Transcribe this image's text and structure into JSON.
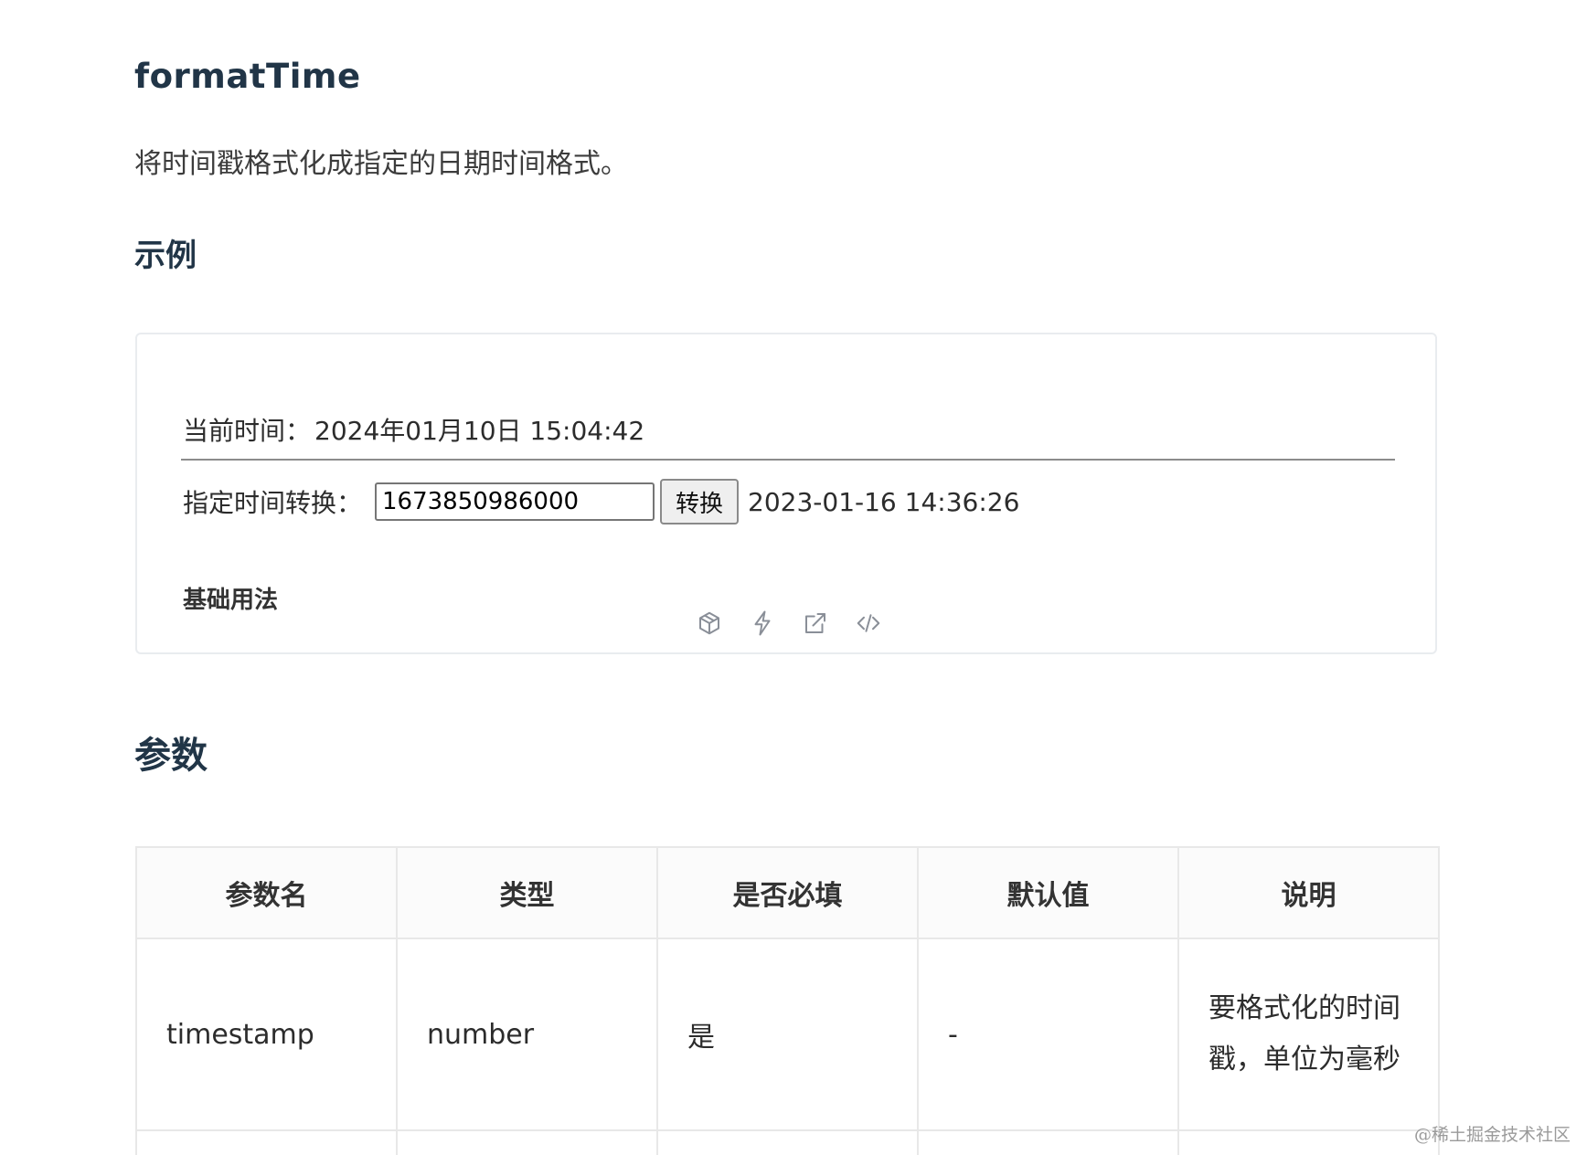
{
  "doc": {
    "title": "formatTime",
    "description": "将时间戳格式化成指定的日期时间格式。"
  },
  "example": {
    "heading": "示例",
    "current_time_label": "当前时间：",
    "current_time_value": "2024年01月10日 15:04:42",
    "convert_label": "指定时间转换：",
    "timestamp_input_value": "1673850986000",
    "convert_button": "转换",
    "convert_result": "2023-01-16 14:36:26",
    "demo_title": "基础用法",
    "actions": [
      "cube-icon",
      "lightning-icon",
      "external-link-icon",
      "code-icon"
    ]
  },
  "params": {
    "heading": "参数",
    "columns": [
      "参数名",
      "类型",
      "是否必填",
      "默认值",
      "说明"
    ],
    "rows": [
      [
        "timestamp",
        "number",
        "是",
        "-",
        "要格式化的时间戳，单位为毫秒"
      ]
    ]
  },
  "watermark": "@稀土掘金技术社区"
}
